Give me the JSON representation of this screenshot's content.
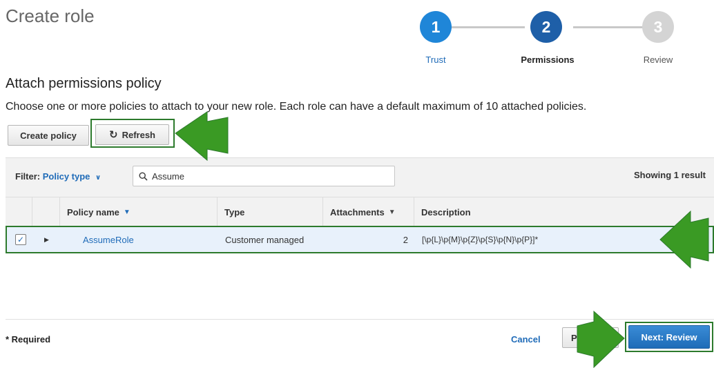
{
  "page": {
    "title": "Create role"
  },
  "stepper": {
    "steps": [
      {
        "number": "1",
        "label": "Trust",
        "color": "#1f86d8",
        "label_color": "#1f6bb8"
      },
      {
        "number": "2",
        "label": "Permissions",
        "color": "#1e5fa8",
        "label_color": "#222222"
      },
      {
        "number": "3",
        "label": "Review",
        "color": "#d4d4d4",
        "label_color": "#555555"
      }
    ],
    "current": 2
  },
  "section": {
    "title": "Attach permissions policy",
    "description": "Choose one or more policies to attach to your new role. Each role can have a default maximum of 10 attached policies."
  },
  "toolbar": {
    "create_policy_label": "Create policy",
    "refresh_label": "Refresh",
    "refresh_icon": "refresh-icon"
  },
  "filter": {
    "label": "Filter:",
    "value": "Policy type",
    "search_value": "Assume",
    "search_placeholder": "Search",
    "showing": "Showing 1 result"
  },
  "table": {
    "columns": {
      "policy_name": "Policy name",
      "type": "Type",
      "attachments": "Attachments",
      "description": "Description"
    },
    "rows": [
      {
        "checked": true,
        "policy_name": "AssumeRole",
        "type": "Customer managed",
        "attachments": "2",
        "description": "[\\p{L}\\p{M}\\p{Z}\\p{S}\\p{N}\\p{P}]*"
      }
    ]
  },
  "footer": {
    "required_label": "* Required",
    "cancel_label": "Cancel",
    "previous_label": "Previous",
    "next_label": "Next: Review"
  },
  "annotations": {
    "arrow_color": "#3a9a24",
    "highlight_color": "#2c7a2c"
  }
}
